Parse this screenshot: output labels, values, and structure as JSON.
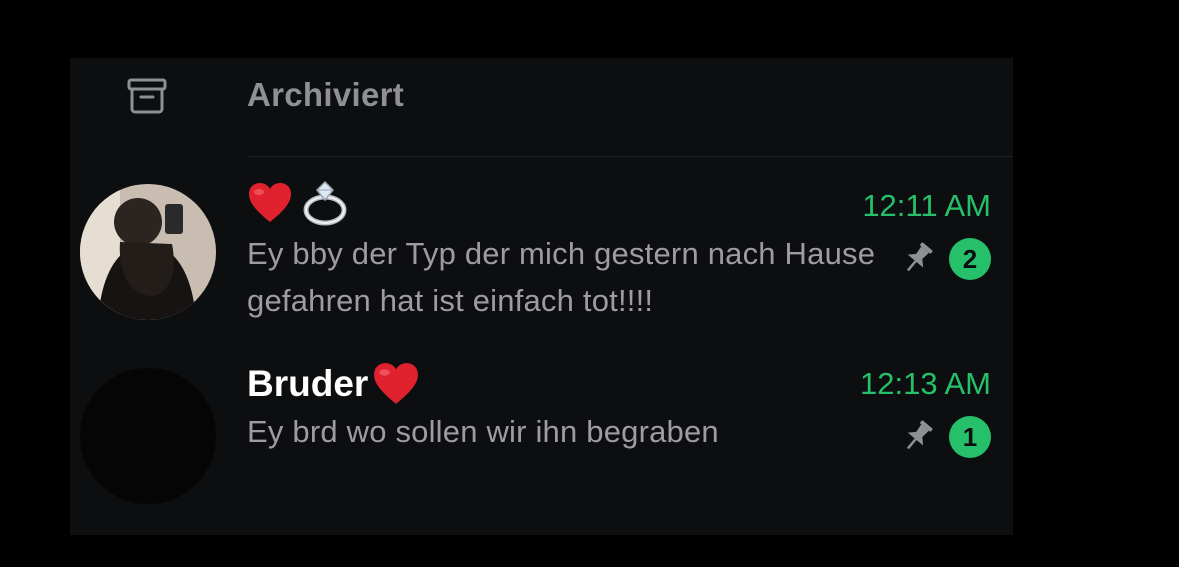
{
  "archived": {
    "label": "Archiviert",
    "icon": "archive-box-icon"
  },
  "chats": [
    {
      "name": "",
      "name_emojis": [
        "heart-icon",
        "ring-icon"
      ],
      "time": "12:11 AM",
      "preview": "Ey bby der Typ der mich gestern nach Hause gefahren hat ist einfach tot!!!!",
      "pinned": true,
      "unread": "2"
    },
    {
      "name": "Bruder",
      "name_emojis": [
        "heart-icon"
      ],
      "time": "12:13 AM",
      "preview": "Ey brd wo sollen wir ihn begraben",
      "pinned": true,
      "unread": "1"
    }
  ],
  "colors": {
    "background": "#000000",
    "panel": "#0d0e10",
    "accent_green": "#25c069",
    "name_text": "#ffffff",
    "preview_text": "#9c9ca1",
    "muted_icon": "#8f9094",
    "heart": "#e0222e"
  }
}
